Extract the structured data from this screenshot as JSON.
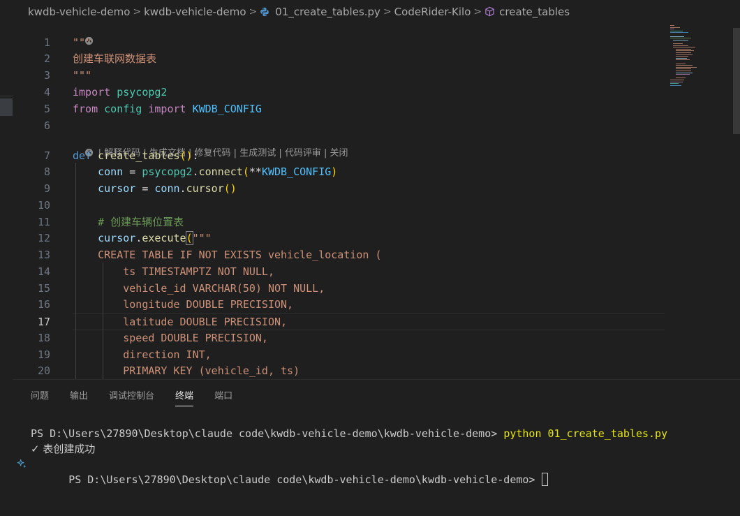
{
  "breadcrumb": {
    "items": [
      "kwdb-vehicle-demo",
      "kwdb-vehicle-demo",
      "01_create_tables.py",
      "CodeRider-Kilo",
      "create_tables"
    ],
    "separator": ">"
  },
  "editor": {
    "active_line": "17",
    "lens_top_icon": "coderider-icon",
    "code_lens": [
      "解释代码",
      "生成文档",
      "修复代码",
      "生成测试",
      "代码评审",
      "关闭"
    ],
    "code_lens_sep": " | ",
    "line_numbers": [
      "1",
      "2",
      "3",
      "4",
      "5",
      "6",
      "7",
      "8",
      "9",
      "10",
      "11",
      "12",
      "13",
      "14",
      "15",
      "16",
      "17",
      "18",
      "19",
      "20"
    ],
    "lines": {
      "l1": "\"\"\"",
      "l2": "创建车联网数据表",
      "l3": "\"\"\"",
      "l4_kw": "import",
      "l4_mod": "psycopg2",
      "l5_from": "from",
      "l5_mod": "config",
      "l5_import": "import",
      "l5_const": "KWDB_CONFIG",
      "l7_def": "def",
      "l7_fn": "create_tables",
      "l7_p1": "(",
      "l7_p2": ")",
      "l7_colon": ":",
      "l8_var": "conn",
      "l8_eq": " = ",
      "l8_mod": "psycopg2",
      "l8_dot": ".",
      "l8_fn": "connect",
      "l8_p1": "(",
      "l8_star": "**",
      "l8_const": "KWDB_CONFIG",
      "l8_p2": ")",
      "l9_var": "cursor",
      "l9_eq": " = ",
      "l9_obj": "conn",
      "l9_dot": ".",
      "l9_fn": "cursor",
      "l9_paren": "()",
      "l11": "# 创建车辆位置表",
      "l12_var": "cursor",
      "l12_dot": ".",
      "l12_fn": "execute",
      "l12_paren": "(",
      "l12_str": "\"\"\"",
      "l13": "CREATE TABLE IF NOT EXISTS vehicle_location (",
      "l14": "ts TIMESTAMPTZ NOT NULL,",
      "l15": "vehicle_id VARCHAR(50) NOT NULL,",
      "l16": "longitude DOUBLE PRECISION,",
      "l17": "latitude DOUBLE PRECISION,",
      "l18": "speed DOUBLE PRECISION,",
      "l19": "direction INT,",
      "l20": "PRIMARY KEY (vehicle_id, ts)"
    }
  },
  "panel": {
    "tabs": [
      "问题",
      "输出",
      "调试控制台",
      "终端",
      "端口"
    ],
    "active_tab": "终端"
  },
  "terminal": {
    "prompt1": "PS D:\\Users\\27890\\Desktop\\claude code\\kwdb-vehicle-demo\\kwdb-vehicle-demo> ",
    "command1": "python 01_create_tables.py",
    "output1": "✓ 表创建成功",
    "prompt2": "PS D:\\Users\\27890\\Desktop\\claude code\\kwdb-vehicle-demo\\kwdb-vehicle-demo> "
  },
  "colors": {
    "background": "#1f1f1f",
    "keyword": "#569cd6",
    "control": "#c586c0",
    "string": "#ce9178",
    "comment": "#6a9955",
    "function": "#dcdcaa",
    "module": "#4ec9b0",
    "constant": "#4fc1ff",
    "terminal_command": "#e5e510"
  }
}
